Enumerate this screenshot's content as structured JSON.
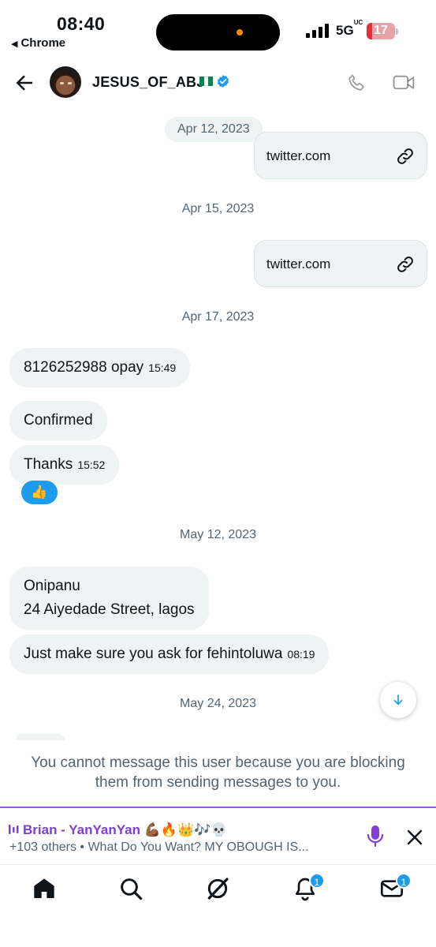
{
  "status_bar": {
    "time": "08:40",
    "back_app": "Chrome",
    "network": "5G",
    "network_suffix": "UC",
    "battery": "17"
  },
  "header": {
    "username": "JESUS_OF_ABJ",
    "flag_colors": [
      "#008751",
      "#ffffff",
      "#008751"
    ],
    "verified": true
  },
  "chat": {
    "dates": {
      "d1": "Apr 12, 2023",
      "d2": "Apr 15, 2023",
      "d3": "Apr 17, 2023",
      "d4": "May 12, 2023",
      "d5": "May 24, 2023"
    },
    "link_cards": [
      {
        "text": "twitter.com",
        "icon": "link-icon"
      },
      {
        "text": "twitter.com",
        "icon": "link-icon"
      }
    ],
    "messages": [
      {
        "text": "8126252988 opay",
        "time": "15:49"
      },
      {
        "text": "Confirmed",
        "time": ""
      },
      {
        "text": "Thanks",
        "time": "15:52",
        "reaction": "👍"
      },
      {
        "line1": "Onipanu",
        "line2": "24 Aiyedade Street, lagos",
        "time": ""
      },
      {
        "text": "Just make sure you ask for fehintoluwa",
        "time": "08:19"
      }
    ]
  },
  "blocked_notice": "You cannot message this user because you are blocking them from sending messages to you.",
  "space": {
    "host": "Brian - YanYanYan",
    "host_emoji": "💪🏾🔥👑🎶💀",
    "subtitle": "+103 others • What Do You Want? MY OBOUGH IS..."
  },
  "tabbar": {
    "notifications_badge": "1",
    "messages_badge": "1"
  },
  "colors": {
    "accent": "#1d9bf0",
    "space_purple": "#7f3fd1",
    "bubble_bg": "#eff3f4",
    "muted_text": "#536471"
  }
}
